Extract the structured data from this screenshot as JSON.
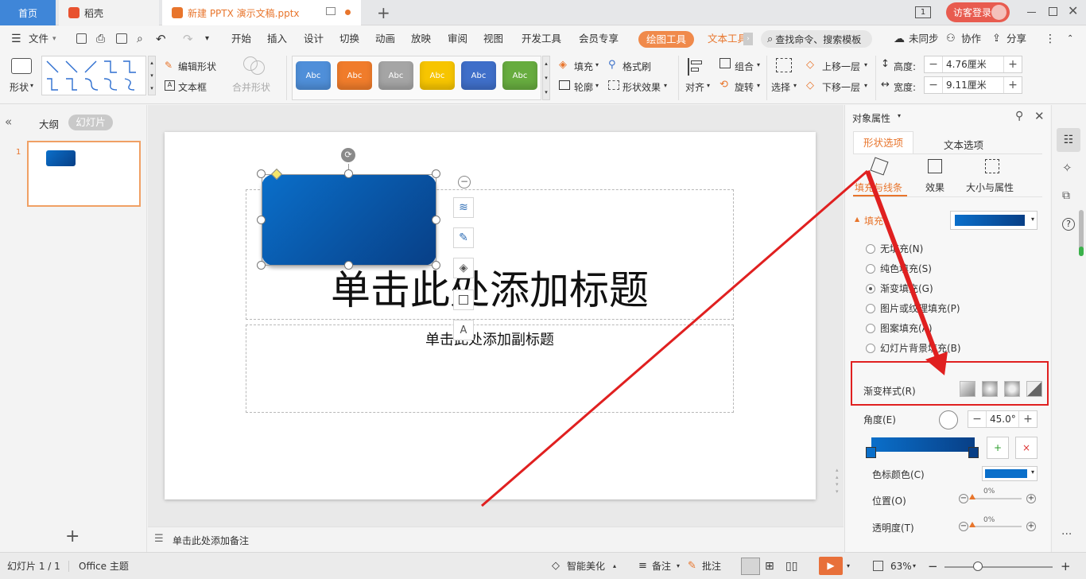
{
  "tabs": {
    "home": "首页",
    "daoke": "稻壳",
    "doc": "新建 PPTX 演示文稿.pptx",
    "new_tab": "+"
  },
  "window": {
    "visitor": "访客登录",
    "page_indicator": "1"
  },
  "menu": {
    "file": "文件",
    "items": [
      "开始",
      "插入",
      "设计",
      "切换",
      "动画",
      "放映",
      "审阅",
      "视图",
      "开发工具",
      "会员专享"
    ],
    "drawing_tools": "绘图工具",
    "text_tools": "文本工具",
    "search_placeholder": "查找命令、搜索模板",
    "sync": "未同步",
    "collab": "协作",
    "share": "分享"
  },
  "ribbon": {
    "shape": "形状",
    "edit_shape": "编辑形状",
    "textbox": "文本框",
    "merge_shape": "合并形状",
    "style_label": "Abc",
    "style_colors": [
      "#4f8fd9",
      "#f07c2b",
      "#a5a5a5",
      "#f7c500",
      "#3f6fc9",
      "#67ac3f"
    ],
    "fill": "填充",
    "format_brush": "格式刷",
    "outline": "轮廓",
    "shape_effect": "形状效果",
    "align": "对齐",
    "group": "组合",
    "rotate": "旋转",
    "select": "选择",
    "bring_forward": "上移一层",
    "send_backward": "下移一层",
    "height_label": "高度:",
    "height_value": "4.76厘米",
    "width_label": "宽度:",
    "width_value": "9.11厘米"
  },
  "leftpanel": {
    "outline": "大纲",
    "slides": "幻灯片",
    "slide_number": "1"
  },
  "slide": {
    "title_placeholder": "单击此处添加标题",
    "subtitle_placeholder": "单击此处添加副标题"
  },
  "notes": {
    "placeholder": "单击此处添加备注"
  },
  "properties": {
    "title": "对象属性",
    "tab_shape": "形状选项",
    "tab_text": "文本选项",
    "sub_fill_line": "填充与线条",
    "sub_effect": "效果",
    "sub_size": "大小与属性",
    "fill_section": "填充",
    "fill_options": [
      "无填充(N)",
      "纯色填充(S)",
      "渐变填充(G)",
      "图片或纹理填充(P)",
      "图案填充(A)",
      "幻灯片背景填充(B)"
    ],
    "selected_fill_index": 2,
    "gradient_style": "渐变样式(R)",
    "angle_label": "角度(E)",
    "angle_value": "45.0°",
    "stop_color_label": "色标颜色(C)",
    "position_label": "位置(O)",
    "position_value": "0%",
    "transparency_label": "透明度(T)",
    "transparency_value": "0%",
    "gradient_start": "#0a6fca",
    "gradient_end": "#083f86"
  },
  "status": {
    "slide_count": "幻灯片 1 / 1",
    "theme": "Office 主题",
    "beautify": "智能美化",
    "notes": "备注",
    "comments": "批注",
    "zoom": "63%"
  },
  "colors": {
    "accent_orange": "#e8752c",
    "drawing_tools_bg": "#f08a4b",
    "annotation_red": "#e02020"
  }
}
